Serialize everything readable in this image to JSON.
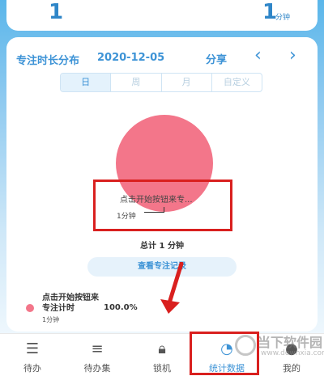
{
  "header": {
    "stat_left_value": "1",
    "stat_right_value": "1",
    "stat_right_unit": "分钟"
  },
  "card": {
    "title": "专注时长分布",
    "date": "2020-12-05",
    "share_label": "分享",
    "prev_icon": "chevron-left-icon",
    "next_icon": "chevron-right-icon",
    "tabs": [
      {
        "label": "日",
        "active": true
      },
      {
        "label": "周",
        "active": false
      },
      {
        "label": "月",
        "active": false
      },
      {
        "label": "自定义",
        "active": false
      }
    ]
  },
  "chart_data": {
    "type": "pie",
    "slices": [
      {
        "label": "点击开始按钮来专...",
        "value": 1,
        "unit": "分钟",
        "percent": 100.0,
        "color": "#f3768a"
      }
    ],
    "slice_label_text": "点击开始按钮来专...",
    "slice_value_text": "1分钟"
  },
  "summary": {
    "total_text": "总计 1 分钟",
    "view_button": "查看专注记录"
  },
  "legend": {
    "name": "点击开始按钮来专注计时",
    "time": "1分钟",
    "percent": "100.0%"
  },
  "bottom_nav": [
    {
      "label": "待办",
      "icon": "menu-lines-icon",
      "active": false
    },
    {
      "label": "待办集",
      "icon": "list-icon",
      "active": false
    },
    {
      "label": "锁机",
      "icon": "lock-icon",
      "active": false
    },
    {
      "label": "统计数据",
      "icon": "stats-icon",
      "active": true
    },
    {
      "label": "我的",
      "icon": "person-icon",
      "active": false
    }
  ],
  "watermark": {
    "text": "当下软件园",
    "sub": "www.downxia.com"
  },
  "colors": {
    "accent": "#3d93d6",
    "pie": "#f3768a",
    "highlight": "#d9201f"
  }
}
